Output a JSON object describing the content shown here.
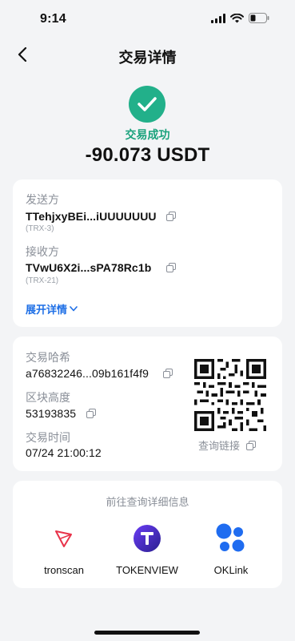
{
  "status_bar": {
    "time": "9:14"
  },
  "nav": {
    "title": "交易详情"
  },
  "status": {
    "text": "交易成功",
    "amount": "-90.073 USDT",
    "color": "#22b08a"
  },
  "sender": {
    "label": "发送方",
    "address": "TTehjxyBEi...iUUUUUUU",
    "tag": "(TRX-3)"
  },
  "receiver": {
    "label": "接收方",
    "address": "TVwU6X2i...sPA78Rc1b",
    "tag": "(TRX-21)"
  },
  "expand": {
    "label": "展开详情"
  },
  "tx": {
    "hash_label": "交易哈希",
    "hash": "a76832246...09b161f4f9",
    "height_label": "区块高度",
    "height": "53193835",
    "time_label": "交易时间",
    "time": "07/24 21:00:12",
    "query_link": "查询链接"
  },
  "explorers": {
    "title": "前往查询详细信息",
    "items": [
      {
        "name": "tronscan",
        "icon": "tronscan-logo"
      },
      {
        "name": "TOKENVIEW",
        "icon": "tokenview-logo"
      },
      {
        "name": "OKLink",
        "icon": "oklink-logo"
      }
    ]
  },
  "colors": {
    "accent": "#1e6fe6",
    "success": "#22b08a",
    "tron_red": "#e8334a",
    "oklink_blue": "#1f6cf0"
  }
}
